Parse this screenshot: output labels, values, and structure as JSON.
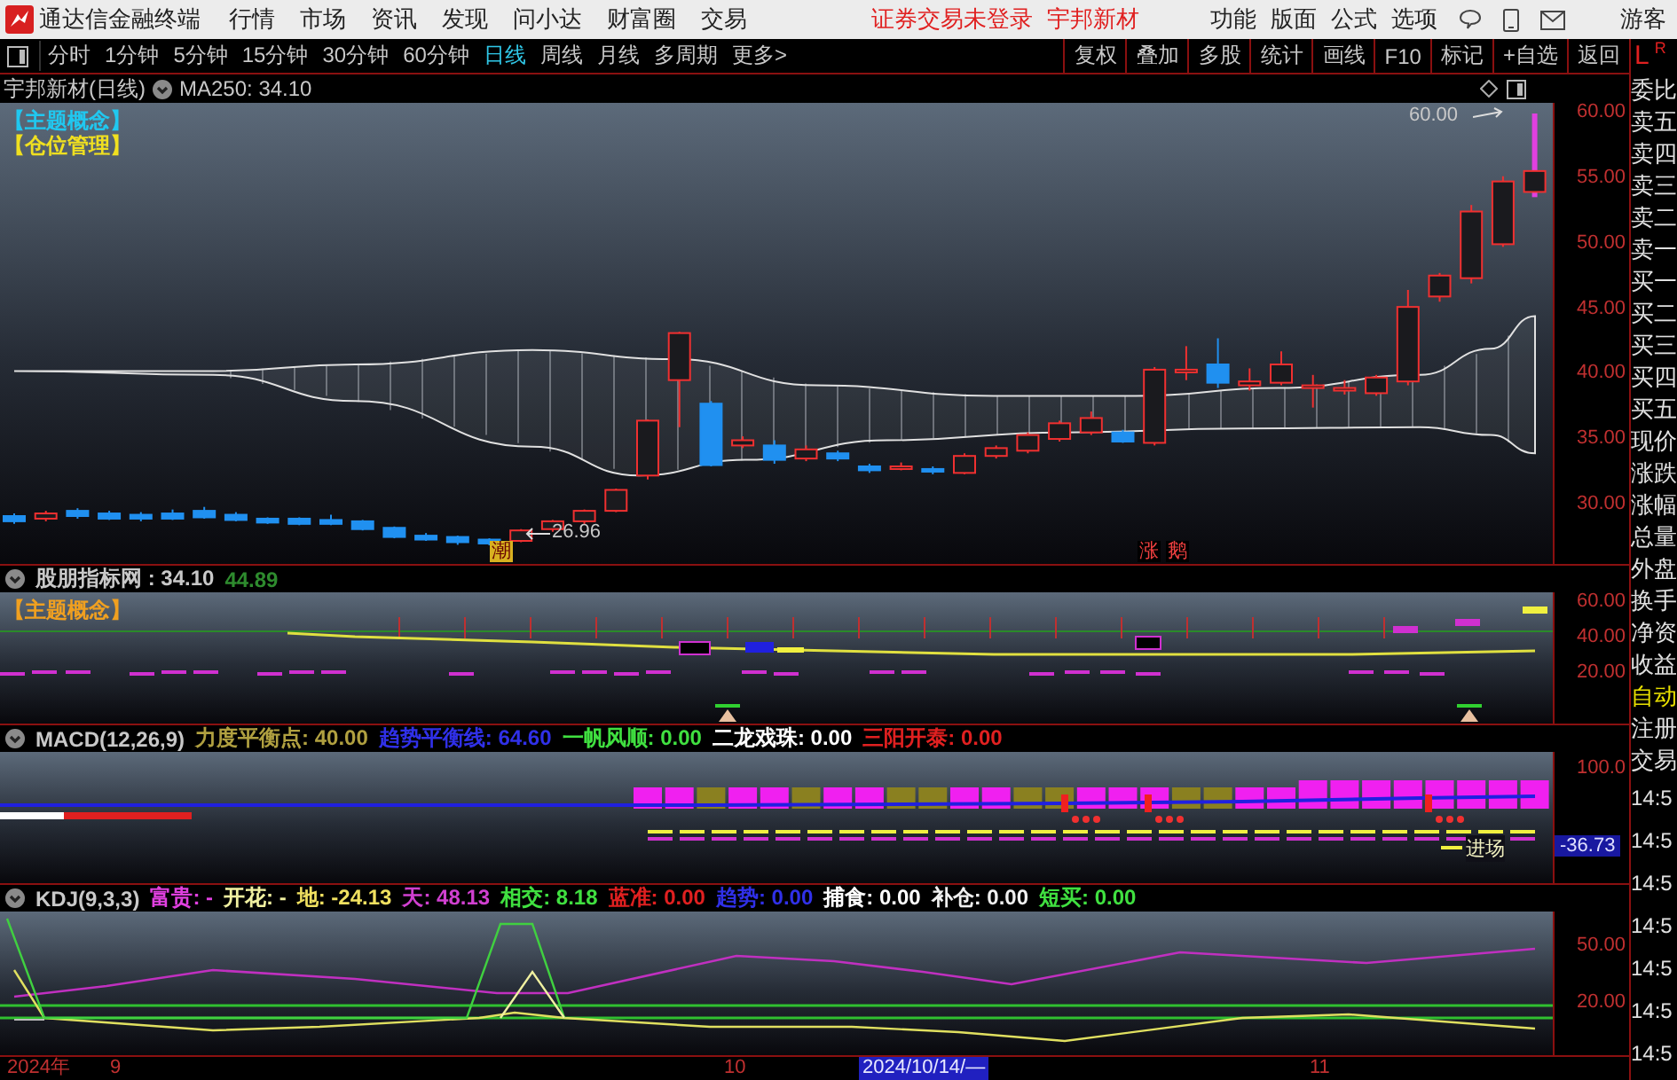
{
  "menu_bar": {
    "app_title": "通达信金融终端",
    "menus": [
      "行情",
      "市场",
      "资讯",
      "发现",
      "问小达",
      "财富圈",
      "交易"
    ],
    "login_status": "证券交易未登录",
    "stock_name": "宇邦新材",
    "tools": [
      "功能",
      "版面",
      "公式",
      "选项"
    ],
    "user": "游客"
  },
  "period_bar": {
    "periods": [
      {
        "label": "分时",
        "selected": false
      },
      {
        "label": "1分钟",
        "selected": false
      },
      {
        "label": "5分钟",
        "selected": false
      },
      {
        "label": "15分钟",
        "selected": false
      },
      {
        "label": "30分钟",
        "selected": false
      },
      {
        "label": "60分钟",
        "selected": false
      },
      {
        "label": "日线",
        "selected": true
      },
      {
        "label": "周线",
        "selected": false
      },
      {
        "label": "月线",
        "selected": false
      },
      {
        "label": "多周期",
        "selected": false
      }
    ],
    "more": "更多>",
    "actions": [
      "复权",
      "叠加",
      "多股",
      "统计",
      "画线",
      "F10",
      "标记",
      "+自选",
      "返回"
    ]
  },
  "main_chart": {
    "title": "宇邦新材(日线)",
    "ma": "MA250: 34.10",
    "tags": [
      {
        "text": "【主题概念】",
        "color": "#20c8f0"
      },
      {
        "text": "【仓位管理】",
        "color": "#f0e020"
      }
    ],
    "y_axis": [
      "60.00",
      "55.00",
      "50.00",
      "45.00",
      "40.00",
      "35.00",
      "30.00"
    ],
    "high_label": "60.00",
    "low_label": "26.96",
    "markers": [
      "潮",
      "涨",
      "鹅"
    ]
  },
  "indicators": [
    {
      "kind": "bands",
      "title": "股朋指标网 : 34.10",
      "value": "44.89",
      "tag": {
        "text": "【主题概念】",
        "color": "#f0a020"
      },
      "y_axis": [
        "60.00",
        "40.00",
        "20.00"
      ]
    },
    {
      "kind": "macd",
      "title": "MACD(12,26,9)",
      "items": [
        {
          "text": "力度平衡点: 40.00",
          "color": "#b0a040"
        },
        {
          "text": "趋势平衡线: 64.60",
          "color": "#3030e8"
        },
        {
          "text": "一帆风顺: 0.00",
          "color": "#40e040"
        },
        {
          "text": "二龙戏珠: 0.00",
          "color": "#ffffff"
        },
        {
          "text": "三阳开泰: 0.00",
          "color": "#e02020"
        }
      ],
      "y_axis": [
        "100.0"
      ],
      "reading": "-36.73",
      "note": "进场"
    },
    {
      "kind": "kdj",
      "title": "KDJ(9,3,3)",
      "items": [
        {
          "text": "富贵: -",
          "color": "#e040e0"
        },
        {
          "text": "开花: -",
          "color": "#f0f0a0"
        },
        {
          "text": "地: -24.13",
          "color": "#f0e060"
        },
        {
          "text": "天: 48.13",
          "color": "#d040d0"
        },
        {
          "text": "相交: 8.18",
          "color": "#40e040"
        },
        {
          "text": "蓝准: 0.00",
          "color": "#e02020"
        },
        {
          "text": "趋势: 0.00",
          "color": "#3030e8"
        },
        {
          "text": "捕食: 0.00",
          "color": "#ffffff"
        },
        {
          "text": "补仓: 0.00",
          "color": "#f0f0f0"
        },
        {
          "text": "短买: 0.00",
          "color": "#40e040"
        }
      ],
      "y_axis": [
        "50.00",
        "20.00"
      ]
    }
  ],
  "date_axis": [
    {
      "text": "2024年",
      "selected": false
    },
    {
      "text": "9",
      "selected": false
    },
    {
      "text": "10",
      "selected": false
    },
    {
      "text": "2024/10/14/—",
      "selected": true
    },
    {
      "text": "11",
      "selected": false
    }
  ],
  "side_panel": {
    "corner": [
      "L",
      "R"
    ],
    "labels": [
      {
        "text": "委比",
        "kind": "normal"
      },
      {
        "text": "卖五",
        "kind": "normal"
      },
      {
        "text": "卖四",
        "kind": "normal"
      },
      {
        "text": "卖三",
        "kind": "normal"
      },
      {
        "text": "卖二",
        "kind": "normal"
      },
      {
        "text": "卖一",
        "kind": "normal"
      },
      {
        "text": "买一",
        "kind": "normal"
      },
      {
        "text": "买二",
        "kind": "normal"
      },
      {
        "text": "买三",
        "kind": "normal"
      },
      {
        "text": "买四",
        "kind": "normal"
      },
      {
        "text": "买五",
        "kind": "normal"
      },
      {
        "text": "现价",
        "kind": "normal"
      },
      {
        "text": "涨跌",
        "kind": "normal"
      },
      {
        "text": "涨幅",
        "kind": "normal"
      },
      {
        "text": "总量",
        "kind": "normal"
      },
      {
        "text": "外盘",
        "kind": "normal"
      },
      {
        "text": "换手",
        "kind": "normal"
      },
      {
        "text": "净资",
        "kind": "normal"
      },
      {
        "text": "收益",
        "kind": "normal"
      },
      {
        "text": "自动",
        "kind": "highlight"
      },
      {
        "text": "注册",
        "kind": "normal"
      },
      {
        "text": "交易",
        "kind": "normal"
      }
    ],
    "times": [
      "14:5",
      "14:5",
      "14:5",
      "14:5",
      "14:5",
      "14:5",
      "14:5"
    ]
  }
}
